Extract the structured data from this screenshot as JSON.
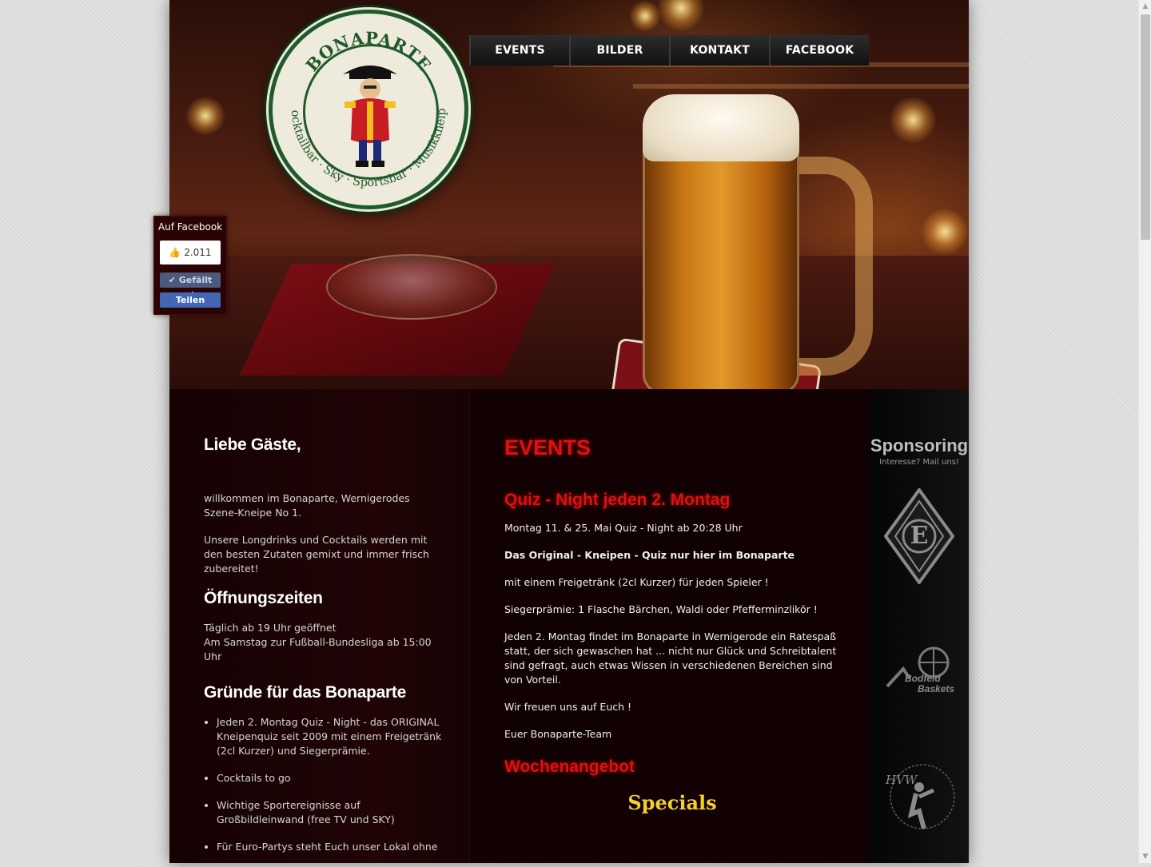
{
  "logo": {
    "name": "BONAPARTE",
    "tagline": "Cocktailbar · Sky · Sportsbar · Musikkneipe"
  },
  "nav": {
    "items": [
      {
        "label": "EVENTS"
      },
      {
        "label": "BILDER"
      },
      {
        "label": "KONTAKT"
      },
      {
        "label": "FACEBOOK"
      }
    ]
  },
  "facebook_widget": {
    "title": "Auf Facebook",
    "count": "2.011",
    "like_label": "Gefällt mir",
    "share_label": "Teilen"
  },
  "left": {
    "greeting": "Liebe Gäste,",
    "welcome": "willkommen im Bonaparte, Wernigerodes Szene-Kneipe No 1.",
    "drinks": "Unsere Longdrinks und Cocktails werden mit den besten Zutaten gemixt und immer frisch zubereitet!",
    "hours_title": "Öffnungszeiten",
    "hours_line1": "Täglich ab 19 Uhr geöffnet",
    "hours_line2": "Am Samstag zur Fußball-Bundesliga ab 15:00 Uhr",
    "reasons_title": "Gründe für das Bonaparte",
    "reasons": [
      "Jeden 2. Montag Quiz - Night - das ORIGINAL Kneipenquiz seit 2009 mit einem Freigetränk (2cl Kurzer) und Siegerprämie.",
      "Cocktails to go",
      "Wichtige Sportereignisse auf Großbildleinwand (free TV und SKY)",
      "Für Euro-Partys steht Euch unser Lokal ohne"
    ]
  },
  "events": {
    "title": "EVENTS",
    "quiz_title": "Quiz - Night jeden 2. Montag",
    "line1": "Montag 11. & 25. Mai Quiz - Night ab 20:28 Uhr",
    "line2": "Das Original - Kneipen - Quiz nur hier im Bonaparte",
    "line3": "mit einem Freigetränk (2cl Kurzer) für jeden Spieler !",
    "line4": "Siegerprämie: 1 Flasche Bärchen, Waldi oder Pfefferminzlikör !",
    "line5": "Jeden 2. Montag findet im Bonaparte in Wernigerode ein Ratespaß statt, der sich gewaschen hat ... nicht nur Glück und Schreibtalent sind gefragt, auch etwas Wissen in verschiedenen Bereichen sind von Vorteil.",
    "line6": "Wir freuen uns auf Euch !",
    "line7": "Euer Bonaparte-Team",
    "weekly_title": "Wochenangebot",
    "specials": "Specials"
  },
  "sponsoring": {
    "title": "Sponsoring",
    "subtitle": "Interesse? Mail uns!",
    "logo1_letter": "E",
    "logo2_line1": "Bodfeld",
    "logo2_line2": "Baskets",
    "logo3_text": "HVW"
  },
  "colors": {
    "accent_red": "#e01010",
    "specials_yellow": "#f5cf2a",
    "logo_green": "#1f5a2a"
  }
}
